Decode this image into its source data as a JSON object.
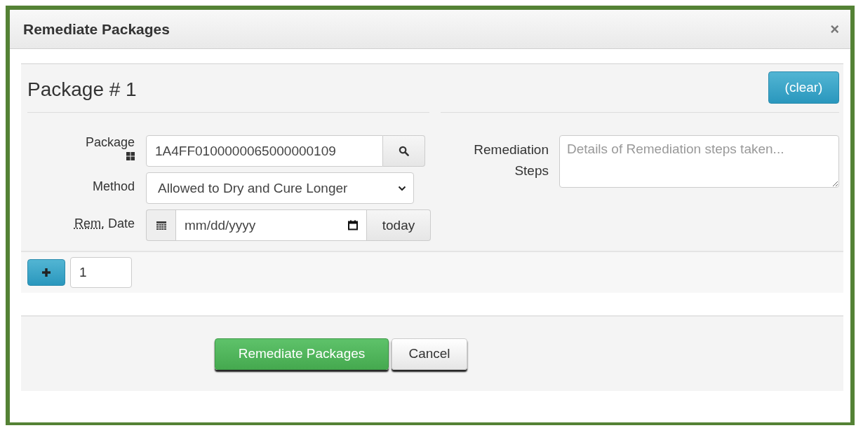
{
  "window": {
    "title": "Remediate Packages",
    "close": "×"
  },
  "package": {
    "heading": "Package # 1",
    "clear_button": "(clear)",
    "package_field": {
      "label": "Package",
      "value": "1A4FF0100000065000000109"
    },
    "method_field": {
      "label": "Method",
      "value": "Allowed to Dry and Cure Longer"
    },
    "date_field": {
      "label_abbr": "Rem.",
      "label": "Date",
      "placeholder": "mm/dd/yyyy",
      "today_button": "today"
    },
    "steps_field": {
      "label": "Remediation Steps",
      "placeholder": "Details of Remediation steps taken..."
    }
  },
  "add_row": {
    "count": "1"
  },
  "buttons": [
    {
      "kind": "primary",
      "label": "Remediate Packages"
    },
    {
      "kind": "default",
      "label": "Cancel"
    }
  ]
}
